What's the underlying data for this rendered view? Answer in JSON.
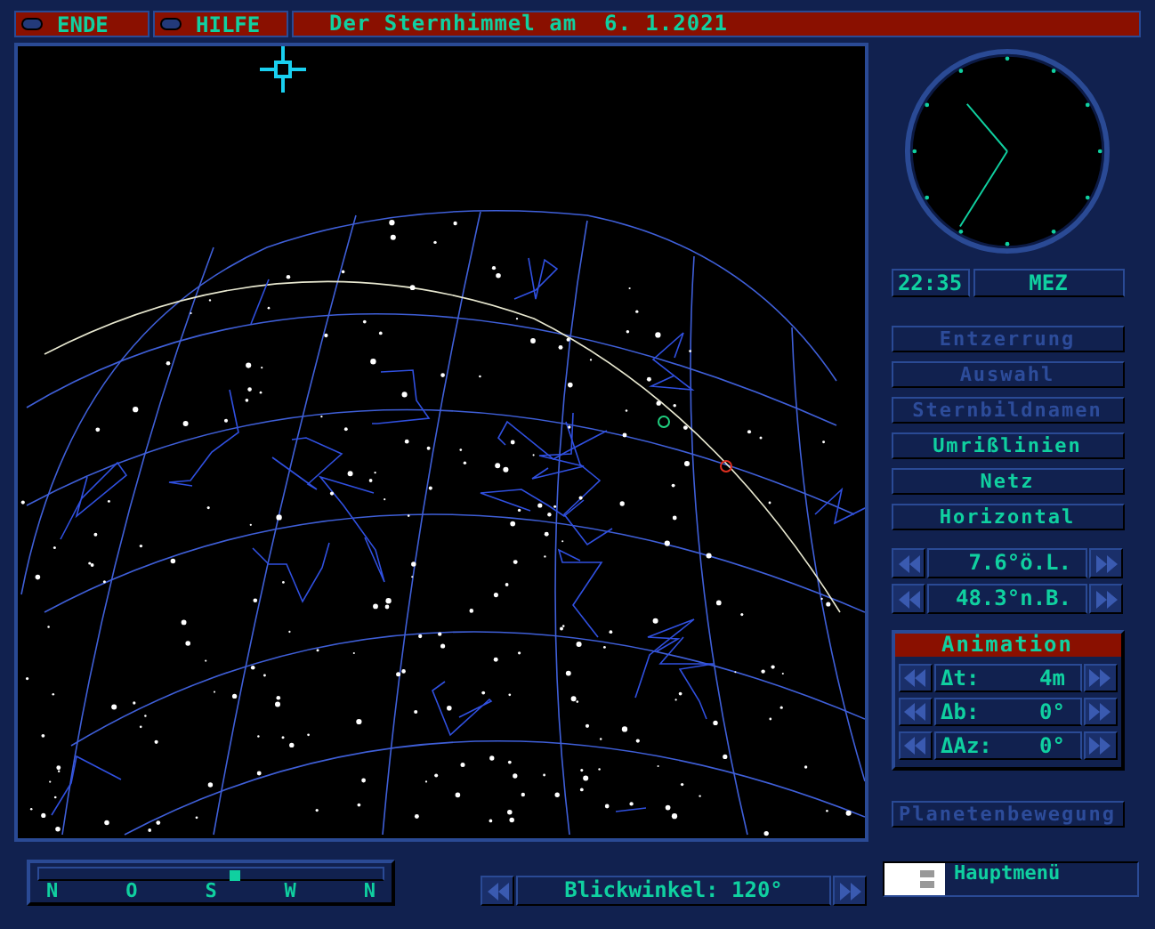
{
  "top_bar": {
    "buttons": [
      {
        "label": "ENDE"
      },
      {
        "label": "HILFE"
      }
    ],
    "title": "Der Sternhimmel am  6. 1.2021"
  },
  "clock": {
    "time": "22:35",
    "zone": "MEZ"
  },
  "toggles": [
    {
      "label": "Entzerrung",
      "enabled": false
    },
    {
      "label": "Auswahl",
      "enabled": false
    },
    {
      "label": "Sternbildnamen",
      "enabled": false
    },
    {
      "label": "Umrißlinien",
      "enabled": true
    },
    {
      "label": "Netz",
      "enabled": true
    },
    {
      "label": "Horizontal",
      "enabled": true
    }
  ],
  "coordinates": [
    {
      "value": "7.6°ö.L."
    },
    {
      "value": "48.3°n.B."
    }
  ],
  "animation": {
    "title": "Animation",
    "rows": [
      {
        "label": "Δt:",
        "value": "4m"
      },
      {
        "label": "Δb:",
        "value": "0°"
      },
      {
        "label": "ΔAz:",
        "value": "0°"
      }
    ]
  },
  "planet_button": {
    "label": "Planetenbewegung",
    "enabled": false
  },
  "main_menu": {
    "label": "Hauptmenü"
  },
  "compass": {
    "labels": [
      "N",
      "O",
      "S",
      "W",
      "N"
    ],
    "level": 0.57
  },
  "view_angle": {
    "label": "Blickwinkel: 120°"
  }
}
